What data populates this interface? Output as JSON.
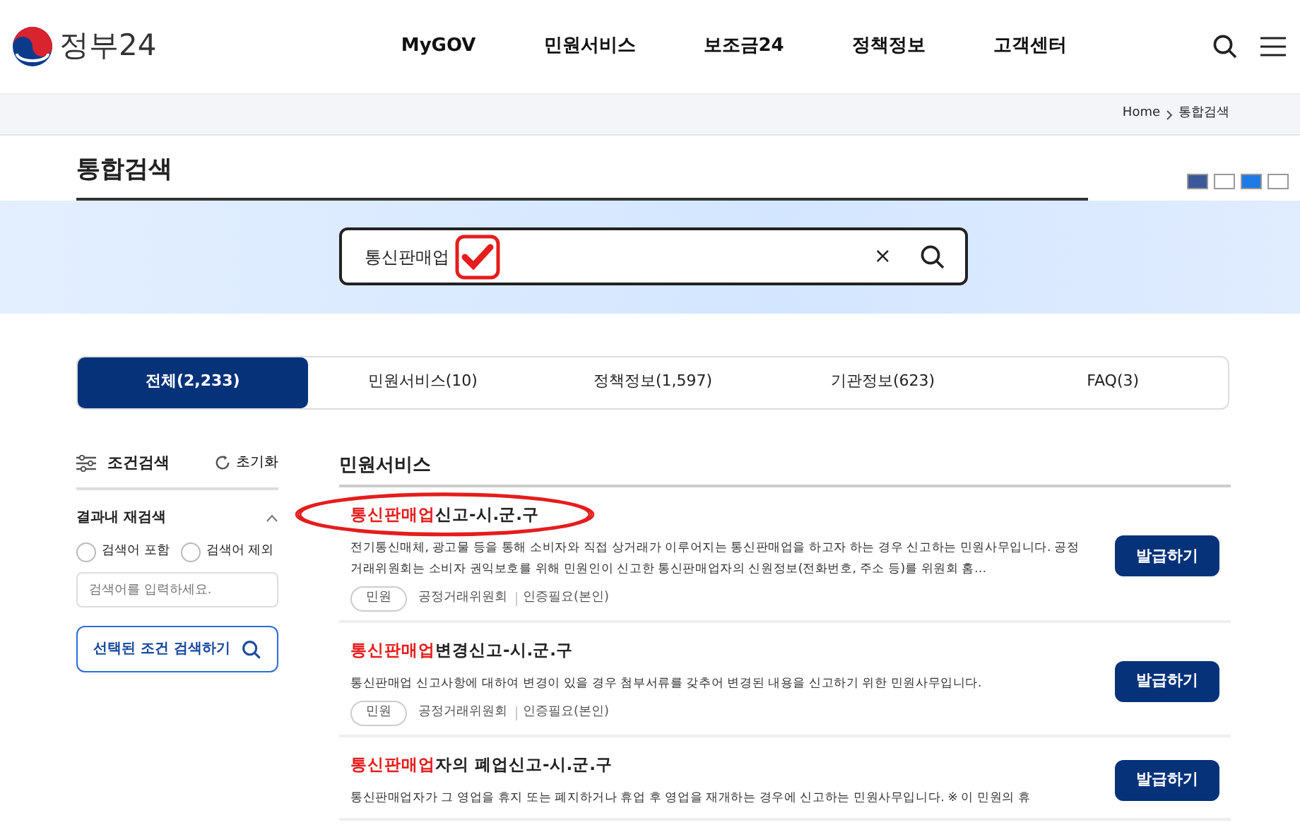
{
  "header": {
    "logo_text": "정부24",
    "nav": [
      "MyGOV",
      "민원서비스",
      "보조금24",
      "정책정보",
      "고객센터"
    ]
  },
  "breadcrumb": [
    "Home",
    "통합검색"
  ],
  "page_title": "통합검색",
  "search": {
    "value": "통신판매업",
    "clear": "×"
  },
  "tabs": [
    {
      "label": "전체(2,233)",
      "selected": true
    },
    {
      "label": "민원서비스(10)",
      "selected": false
    },
    {
      "label": "정책정보(1,597)",
      "selected": false
    },
    {
      "label": "기관정보(623)",
      "selected": false
    },
    {
      "label": "FAQ(3)",
      "selected": false
    }
  ],
  "filter": {
    "title": "조건검색",
    "reset": "초기화",
    "section": "결과내 재검색",
    "options": [
      {
        "label": "검색어 포함",
        "selected": false
      },
      {
        "label": "검색어 제외",
        "selected": false
      }
    ],
    "placeholder": "검색어를 입력하세요.",
    "button": "선택된 조건 검색하기"
  },
  "results": {
    "heading": "민원서비스",
    "items": [
      {
        "highlight": "통신판매업",
        "title_rest": "신고-시.군.구",
        "description": "전기통신매체, 광고물 등을 통해 소비자와 직접 상거래가 이루어지는 통신판매업을 하고자 하는 경우 신고하는 민원사무입니다. 공정거래위원회는 소비자 권익보호를 위해 민원인이 신고한 통신판매업자의 신원정보(전화번호, 주소 등)를 위원회 홈…",
        "tag": "민원",
        "agency": "공정거래위원회",
        "auth": "인증필요(본인)",
        "button": "발급하기",
        "circled": true
      },
      {
        "highlight": "통신판매업",
        "title_rest": "변경신고-시.군.구",
        "description": "통신판매업 신고사항에 대하여 변경이 있을 경우 첨부서류를 갖추어 변경된 내용을 신고하기 위한 민원사무입니다.",
        "tag": "민원",
        "agency": "공정거래위원회",
        "auth": "인증필요(본인)",
        "button": "발급하기",
        "circled": false
      },
      {
        "highlight": "통신판매업",
        "title_rest": "자의 폐업신고-시.군.구",
        "description": "통신판매업자가 그 영업을 휴지 또는 폐지하거나 휴업 후 영업을 재개하는 경우에 신고하는 민원사무입니다. ※ 이 민원의 휴",
        "button": "발급하기",
        "circled": false
      }
    ]
  }
}
